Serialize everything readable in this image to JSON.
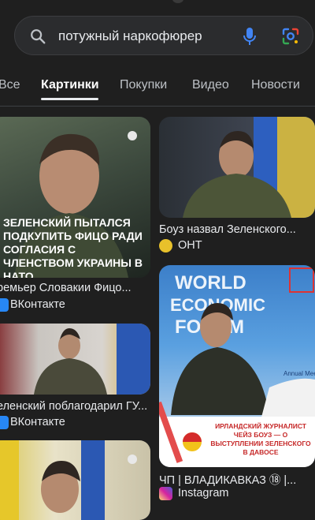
{
  "search": {
    "query": "потужный наркофюрер"
  },
  "tabs": [
    {
      "label": "Все"
    },
    {
      "label": "Картинки"
    },
    {
      "label": "Покупки"
    },
    {
      "label": "Видео"
    },
    {
      "label": "Новости"
    }
  ],
  "results": [
    {
      "caption": "ремьер Словакии Фицо...",
      "source": "ВКонтакте",
      "overlay": "ЗЕЛЕНСКИЙ ПЫТАЛСЯ ПОДКУПИТЬ ФИЦО РАДИ СОГЛАСИЯ С ЧЛЕНСТВОМ УКРАИНЫ В НАТО"
    },
    {
      "caption": "Боуз назвал Зеленского...",
      "source": "ОНТ"
    },
    {
      "caption": "еленский поблагодарил ГУ...",
      "source": "ВКонтакте"
    },
    {
      "caption": "ЧП | ВЛАДИКАВКАЗ ⑱ |...",
      "source": "Instagram",
      "overlay_top": "WORLD ECONOMIC FORUM",
      "banner": "ИРЛАНДСКИЙ ЖУРНАЛИСТ ЧЕЙЗ БОУЗ — О ВЫСТУПЛЕНИИ ЗЕЛЕНСКОГО В ДАВОСЕ",
      "sign": "Annual Meeting"
    },
    {
      "caption": "",
      "source": ""
    }
  ],
  "colors": {
    "background": "#1f1f1f",
    "search_bg": "#2b2c2e",
    "vk_blue": "#2787f5",
    "insta_pink": "#d6249f"
  },
  "icons": [
    "search-icon",
    "microphone-icon",
    "google-lens-icon",
    "vk-icon",
    "ont-icon",
    "instagram-icon",
    "video-badge-icon"
  ]
}
